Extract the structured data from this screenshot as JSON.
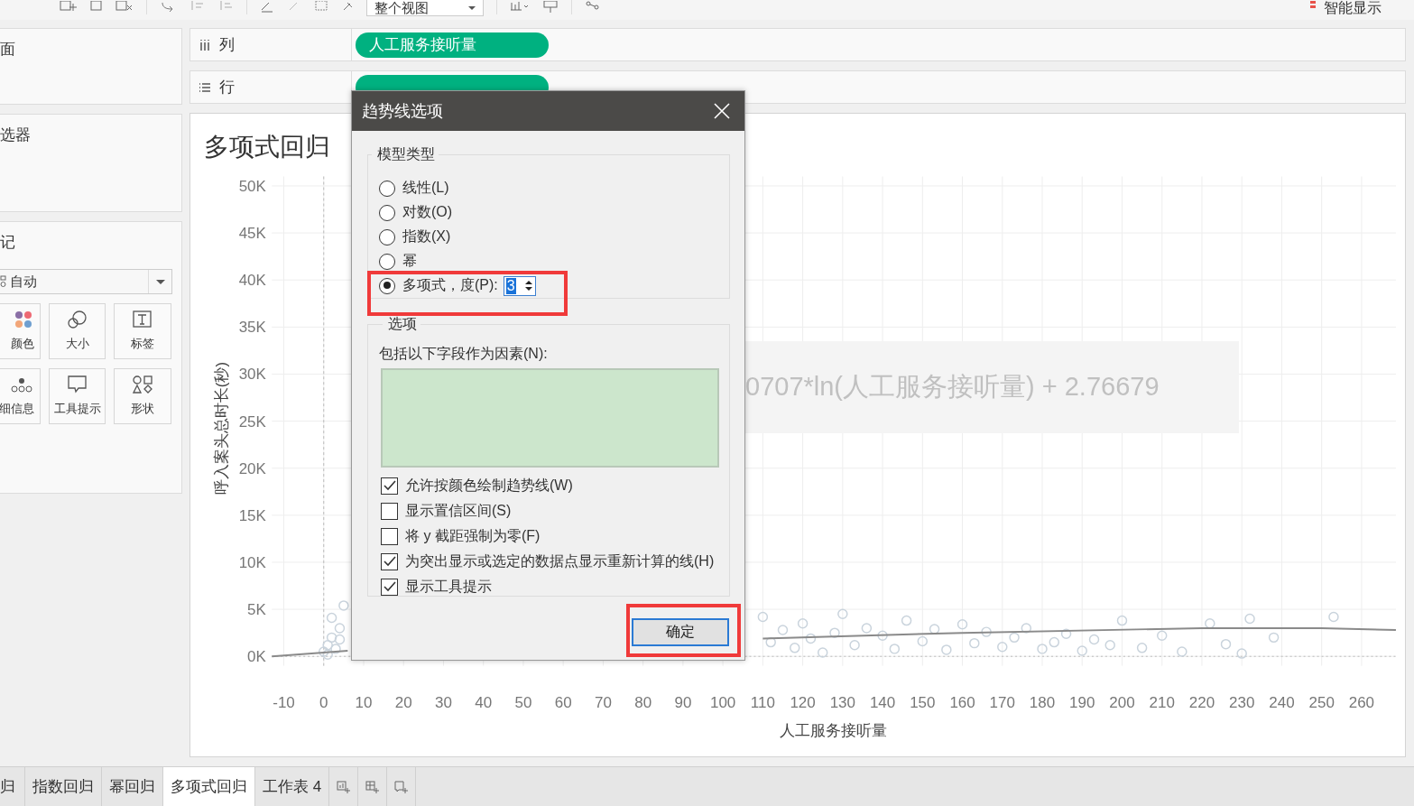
{
  "toolbar": {
    "view_dropdown": "整个视图",
    "show_me": "智能显示"
  },
  "left_panel": {
    "pages_title": "面",
    "filters_title": "选器",
    "marks_title": "记",
    "mark_type": "自动",
    "mark_buttons": [
      {
        "kind": "color",
        "label": "颜色"
      },
      {
        "kind": "size",
        "label": "大小"
      },
      {
        "kind": "label",
        "label": "标签"
      },
      {
        "kind": "detail",
        "label": "细信息"
      },
      {
        "kind": "tooltip",
        "label": "工具提示"
      },
      {
        "kind": "shape",
        "label": "形状"
      }
    ]
  },
  "shelves": [
    {
      "kind": "columns",
      "label": "列",
      "pill": "人工服务接听量"
    },
    {
      "kind": "rows",
      "label": "行"
    }
  ],
  "chart": {
    "title": "多项式回归",
    "tooltip": "0707*ln(人工服务接听量) + 2.76679",
    "chart_data": {
      "type": "scatter",
      "xlabel": "人工服务接听量",
      "ylabel": "呼入案头总时长(秒)",
      "xlim": [
        -13,
        268.6
      ],
      "ylim": [
        -1000,
        51000
      ],
      "grid": true,
      "xticks": [
        -10,
        0,
        10,
        20,
        30,
        40,
        50,
        60,
        70,
        80,
        90,
        100,
        110,
        120,
        130,
        140,
        150,
        160,
        170,
        180,
        190,
        200,
        210,
        220,
        230,
        240,
        250,
        260
      ],
      "yticks": [
        {
          "value": 0,
          "label": "0K"
        },
        {
          "value": 5000,
          "label": "5K"
        },
        {
          "value": 10000,
          "label": "10K"
        },
        {
          "value": 15000,
          "label": "15K"
        },
        {
          "value": 20000,
          "label": "20K"
        },
        {
          "value": 25000,
          "label": "25K"
        },
        {
          "value": 30000,
          "label": "30K"
        },
        {
          "value": 35000,
          "label": "35K"
        },
        {
          "value": 40000,
          "label": "40K"
        },
        {
          "value": 45000,
          "label": "45K"
        },
        {
          "value": 50000,
          "label": "50K"
        }
      ],
      "series": [
        {
          "color": "#c9d3dc",
          "x": [
            0,
            1,
            2,
            3,
            4,
            5,
            2,
            1,
            4,
            110,
            112,
            115,
            118,
            120,
            122,
            125,
            128,
            130,
            133,
            136,
            140,
            143,
            146,
            150,
            153,
            156,
            160,
            163,
            166,
            170,
            173,
            176,
            180,
            183,
            186,
            190,
            193,
            197,
            200,
            205,
            210,
            215,
            222,
            226,
            230,
            232,
            238,
            253
          ],
          "values": [
            500,
            1200,
            2000,
            800,
            3000,
            5400,
            4100,
            200,
            1800,
            4200,
            1500,
            2800,
            900,
            3500,
            1900,
            400,
            2500,
            4500,
            1200,
            3000,
            2200,
            800,
            3800,
            1600,
            2900,
            700,
            3400,
            1400,
            2600,
            1000,
            2000,
            3000,
            800,
            1500,
            2400,
            600,
            1800,
            1200,
            3800,
            900,
            2200,
            500,
            3500,
            1300,
            300,
            4000,
            2000,
            4200
          ]
        },
        {
          "type": "line",
          "color": "#8a8a8a",
          "x": [
            -13,
            0,
            6,
            50,
            110,
            160,
            220,
            250,
            268.6
          ],
          "values": [
            0,
            400,
            600,
            null,
            1900,
            2500,
            3000,
            3000,
            2800
          ]
        }
      ]
    }
  },
  "dialog": {
    "title": "趋势线选项",
    "model_group": "模型类型",
    "models": [
      {
        "label": "线性(L)",
        "selected": false
      },
      {
        "label": "对数(O)",
        "selected": false
      },
      {
        "label": "指数(X)",
        "selected": false
      },
      {
        "label": "幂",
        "selected": false
      },
      {
        "label": "多项式，度(P):",
        "selected": true,
        "degree": "3"
      }
    ],
    "options_group": "选项",
    "factors_label": "包括以下字段作为因素(N):",
    "options": [
      {
        "label": "允许按颜色绘制趋势线(W)",
        "checked": true
      },
      {
        "label": "显示置信区间(S)",
        "checked": false
      },
      {
        "label": "将 y 截距强制为零(F)",
        "checked": false
      },
      {
        "label": "为突出显示或选定的数据点显示重新计算的线(H)",
        "checked": true
      },
      {
        "label": "显示工具提示",
        "checked": true
      }
    ],
    "ok_button": "确定"
  },
  "bottom_tabs": [
    {
      "label": "归",
      "selected": false
    },
    {
      "label": "指数回归",
      "selected": false
    },
    {
      "label": "幂回归",
      "selected": false
    },
    {
      "label": "多项式回归",
      "selected": true
    },
    {
      "label": "工作表 4",
      "selected": false
    }
  ]
}
